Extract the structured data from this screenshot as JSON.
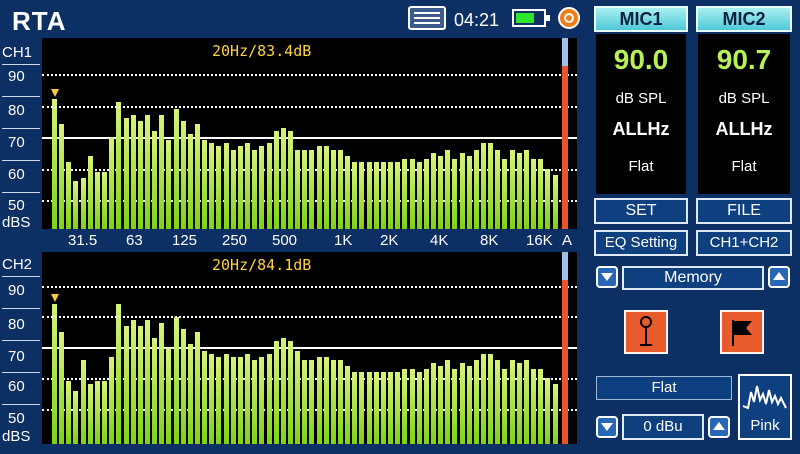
{
  "header": {
    "title": "RTA",
    "time": "04:21"
  },
  "icons": {
    "keyboard": "keyboard-icon",
    "battery": "battery-icon",
    "record": "record-icon"
  },
  "colors": {
    "accent_green": "#b8f05a",
    "readout_yellow": "#ffd23a",
    "bar_green": "#9be23a",
    "marker_red": "#e8542b",
    "button_cyan": "#6fd9e3",
    "action_red": "#e85b2c"
  },
  "channels": {
    "ch1": {
      "label": "CH1",
      "readout": "20Hz/83.4dB",
      "y_ticks": [
        "90",
        "80",
        "70",
        "60",
        "50"
      ],
      "unit": "dBS",
      "bars": [
        82,
        74,
        62,
        56,
        57,
        64,
        59,
        59,
        70,
        81,
        76,
        77,
        75,
        77,
        72,
        77,
        69,
        79,
        75,
        71,
        74,
        69,
        68,
        67,
        68,
        66,
        67,
        68,
        66,
        67,
        68,
        72,
        73,
        72,
        66,
        66,
        66,
        67,
        67,
        66,
        66,
        64,
        62,
        62,
        62,
        62,
        62,
        62,
        62,
        63,
        63,
        62,
        63,
        65,
        64,
        66,
        63,
        65,
        64,
        66,
        68,
        68,
        66,
        63,
        66,
        65,
        66,
        63,
        63,
        60,
        58
      ]
    },
    "ch2": {
      "label": "CH2",
      "readout": "20Hz/84.1dB",
      "y_ticks": [
        "90",
        "80",
        "70",
        "60",
        "50"
      ],
      "unit": "dBS",
      "bars": [
        84,
        75,
        59,
        56,
        66,
        58,
        59,
        59,
        67,
        84,
        77,
        79,
        77,
        79,
        73,
        78,
        70,
        80,
        76,
        71,
        75,
        69,
        68,
        67,
        68,
        67,
        67,
        68,
        66,
        67,
        68,
        72,
        73,
        72,
        69,
        66,
        66,
        67,
        67,
        66,
        66,
        64,
        62,
        62,
        62,
        62,
        62,
        62,
        62,
        63,
        63,
        62,
        63,
        65,
        64,
        66,
        63,
        65,
        64,
        66,
        68,
        68,
        66,
        63,
        66,
        65,
        66,
        63,
        63,
        60,
        58
      ]
    },
    "peak_marker_index": 0
  },
  "freq_axis": [
    "31.5",
    "63",
    "125",
    "250",
    "500",
    "1K",
    "2K",
    "4K",
    "8K",
    "16K",
    "A"
  ],
  "mic1": {
    "label": "MIC1",
    "value": "90.0",
    "unit": "dB SPL",
    "weighting": "ALLHz",
    "filter": "Flat"
  },
  "mic2": {
    "label": "MIC2",
    "value": "90.7",
    "unit": "dB SPL",
    "weighting": "ALLHz",
    "filter": "Flat"
  },
  "buttons": {
    "set": "SET",
    "file": "FILE",
    "eq_setting": "EQ Setting",
    "ch_mode": "CH1+CH2",
    "memory": "Memory",
    "flat": "Flat",
    "level": "0 dBu",
    "pink": "Pink"
  }
}
